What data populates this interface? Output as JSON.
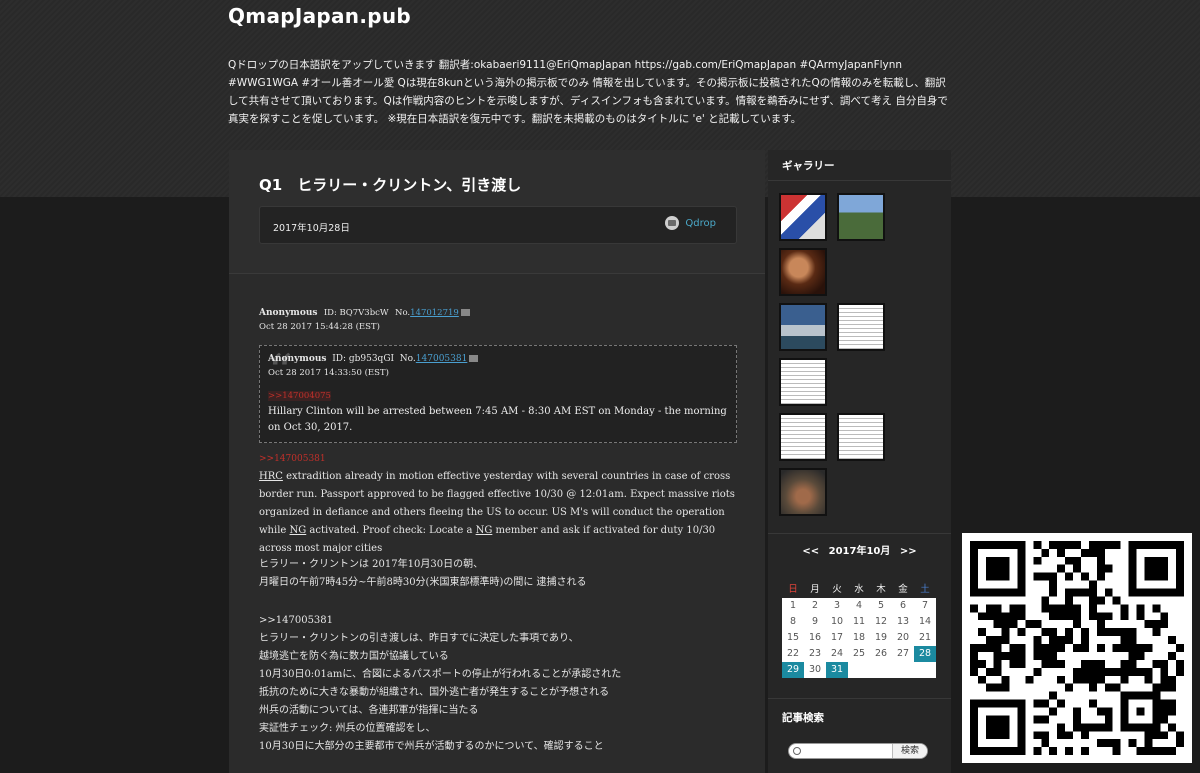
{
  "site": {
    "title": "QmapJapan.pub",
    "description": "Qドロップの日本語訳をアップしていきます 翻訳者:okabaeri9111@EriQmapJapan https://gab.com/EriQmapJapan #QArmyJapanFlynn #WWG1WGA #オール善オール愛 Qは現在8kunという海外の掲示板でのみ 情報を出しています。その掲示板に投稿されたQの情報のみを転載し、翻訳して共有させて頂いております。Qは作戦内容のヒントを示唆しますが、ディスインフォも含まれています。情報を鵜呑みにせず、調べて考え 自分自身で真実を探すことを促しています。 ※現在日本語訳を復元中です。翻訳を未掲載のものはタイトルに 'e' と記載しています。"
  },
  "post": {
    "title": "Q1　ヒラリー・クリントン、引き渡し",
    "date": "2017年10月28日",
    "category": "Qdrop",
    "header": {
      "author": "Anonymous",
      "id": "ID: BQ7V3bcW",
      "no_label": "No.",
      "no": "147012719",
      "datetime": "Oct 28 2017 15:44:28 (EST)"
    },
    "quote": {
      "author": "Anonymous",
      "id": "ID: gb953qGI",
      "no_label": "No.",
      "no": "147005381",
      "datetime": "Oct 28 2017 14:33:50 (EST)",
      "ref": ">>147004075",
      "text": "Hillary Clinton will be arrested between 7:45 AM - 8:30 AM EST on Monday - the morning on Oct 30, 2017."
    },
    "reply_ref": ">>147005381",
    "english": {
      "hrc": "HRC",
      "p1": " extradition already in motion effective yesterday with several countries in case of cross border run. Passport approved to be flagged effective 10/30 @ 12:01am. Expect massive riots organized in defiance and others fleeing the US to occur. US M's will conduct the operation while ",
      "ng1": "NG",
      "p2": " activated. Proof check: Locate a ",
      "ng2": "NG",
      "p3": " member and ask if activated for duty 10/30 across most major cities"
    },
    "japanese1": [
      "ヒラリー・クリントンは 2017年10月30日の朝、",
      "月曜日の午前7時45分~午前8時30分(米国東部標準時)の間に 逮捕される"
    ],
    "japanese2": [
      ">>147005381",
      "ヒラリー・クリントンの引き渡しは、昨日すでに決定した事項であり、",
      "越境逃亡を防ぐ為に数カ国が協議している",
      "10月30日0:01amに、合図によるパスポートの停止が行われることが承認された",
      "抵抗のために大きな暴動が組織され、国外逃亡者が発生することが予想される",
      "州兵の活動については、各連邦軍が指揮に当たる",
      "実証性チェック: 州兵の位置確認をし、",
      "10月30日に大部分の主要都市で州兵が活動するのかについて、確認すること"
    ]
  },
  "sidebar": {
    "gallery_title": "ギャラリー",
    "calendar": {
      "prev": "<<",
      "month": "2017年10月",
      "next": ">>",
      "weekdays": [
        "日",
        "月",
        "火",
        "水",
        "木",
        "金",
        "土"
      ],
      "days": [
        [
          "1",
          "2",
          "3",
          "4",
          "5",
          "6",
          "7"
        ],
        [
          "8",
          "9",
          "10",
          "11",
          "12",
          "13",
          "14"
        ],
        [
          "15",
          "16",
          "17",
          "18",
          "19",
          "20",
          "21"
        ],
        [
          "22",
          "23",
          "24",
          "25",
          "26",
          "27",
          "28"
        ],
        [
          "29",
          "30",
          "31",
          "",
          "",
          "",
          ""
        ]
      ],
      "highlighted": [
        "28",
        "29",
        "31"
      ]
    },
    "search_title": "記事検索",
    "search_button": "検索"
  }
}
